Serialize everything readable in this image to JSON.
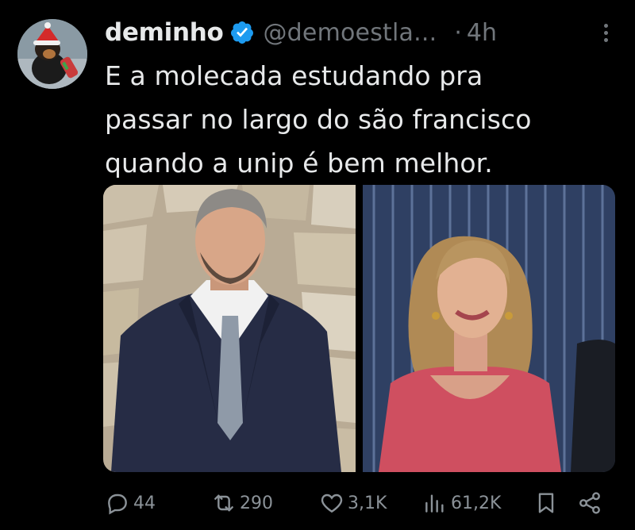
{
  "tweet": {
    "author_name": "deminho",
    "handle": "@demoestla...",
    "separator": "·",
    "time": "4h",
    "text_lines": [
      "E a molecada estudando pra",
      "passar no largo do são francisco",
      "quando a unip é bem melhor."
    ]
  },
  "actions": {
    "replies": "44",
    "retweets": "290",
    "likes": "3,1K",
    "views": "61,2K"
  },
  "colors": {
    "background": "#000000",
    "text": "#e7e9ea",
    "secondary": "#71767b",
    "verified": "#1d9bf0"
  },
  "icons": [
    "verified-badge-icon",
    "more-icon",
    "reply-icon",
    "retweet-icon",
    "like-icon",
    "views-icon",
    "bookmark-icon",
    "share-icon"
  ]
}
